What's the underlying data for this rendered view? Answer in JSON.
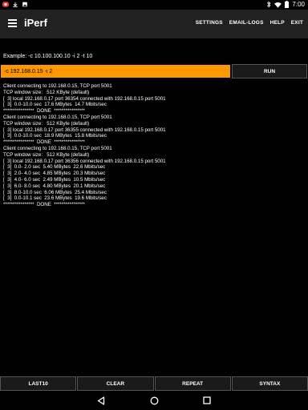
{
  "status_bar": {
    "time": "7:00",
    "left_icons": [
      "record-icon",
      "download-icon",
      "image-icon"
    ],
    "right_icons": [
      "bluetooth-icon",
      "wifi-icon",
      "battery-icon"
    ]
  },
  "app_bar": {
    "title": "iPerf",
    "menu": [
      "SETTINGS",
      "EMAIL-LOGS",
      "HELP",
      "EXIT"
    ]
  },
  "example": "Example: -c 10.100.100.10 -i 2 -t 10",
  "input": {
    "value": "-c 192.168.0.15 -i 2",
    "placeholder": ""
  },
  "run_label": "RUN",
  "output_lines": [
    "Client connecting to 192.168.0.15, TCP port 5001",
    "TCP window size:   512 KByte (default)",
    "[  3] local 192.168.0.17 port 36354 connected with 192.168.0.15 port 5001",
    "[  3]  0.0-10.0 sec  17.6 MBytes  14.7 Mbits/sec",
    "****************  DONE  ****************",
    "Client connecting to 192.168.0.15, TCP port 5001",
    "TCP window size:   512 KByte (default)",
    "[  3] local 192.168.0.17 port 36355 connected with 192.168.0.15 port 5001",
    "[  3]  0.0-10.0 sec  18.9 MBytes  15.8 Mbits/sec",
    "****************  DONE  ****************",
    "Client connecting to 192.168.0.15, TCP port 5001",
    "TCP window size:   512 KByte (default)",
    "[  3] local 192.168.0.17 port 36356 connected with 192.168.0.15 port 5001",
    "[  3]  0.0- 2.0 sec  5.40 MBytes  22.6 Mbits/sec",
    "[  3]  2.0- 4.0 sec  4.85 MBytes  20.3 Mbits/sec",
    "[  3]  4.0- 6.0 sec  2.49 MBytes  10.5 Mbits/sec",
    "[  3]  6.0- 8.0 sec  4.80 MBytes  20.1 Mbits/sec",
    "[  3]  8.0-10.0 sec  6.06 MBytes  25.4 Mbits/sec",
    "[  3]  0.0-10.1 sec  23.6 MBytes  19.6 Mbits/sec",
    "****************  DONE  ****************"
  ],
  "bottom_buttons": [
    "LAST10",
    "CLEAR",
    "REPEAT",
    "SYNTAX"
  ],
  "colors": {
    "accent": "#ff9800",
    "app_bar": "#212121",
    "background": "#000000",
    "button_bg": "#1a1a1a"
  }
}
